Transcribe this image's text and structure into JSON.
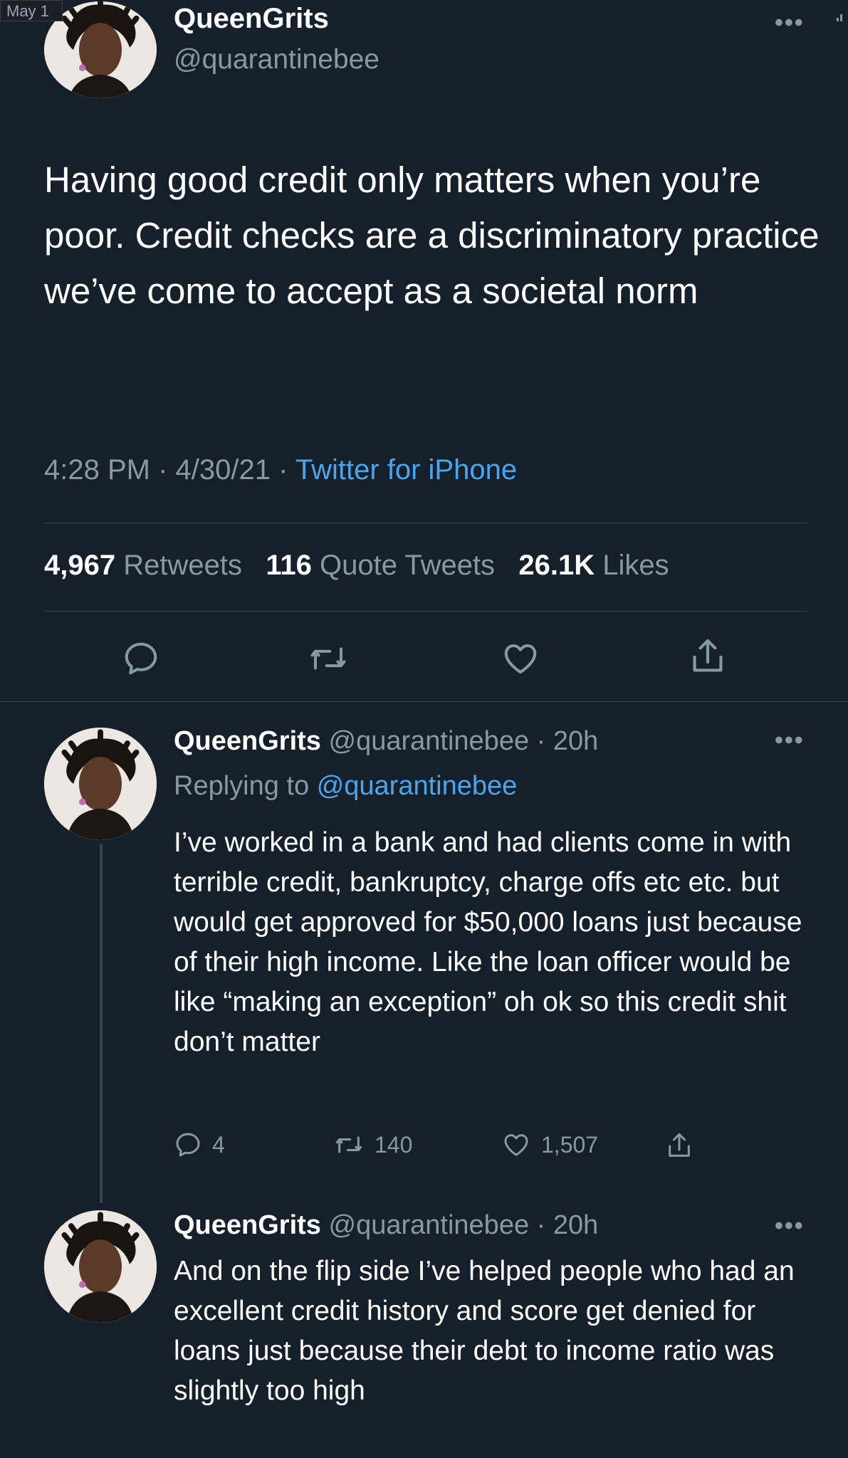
{
  "status_bar": {
    "corner_label": "May 1"
  },
  "main_tweet": {
    "display_name": "QueenGrits",
    "handle": "@quarantinebee",
    "text": "Having good credit only matters when you’re poor. Credit checks are a discriminatory practice we’ve come to accept as a societal norm",
    "time": "4:28 PM",
    "date": "4/30/21",
    "source": "Twitter for iPhone",
    "stats": {
      "retweets_count": "4,967",
      "retweets_label": "Retweets",
      "quotes_count": "116",
      "quotes_label": "Quote Tweets",
      "likes_count": "26.1K",
      "likes_label": "Likes"
    },
    "icons": [
      "reply-icon",
      "retweet-icon",
      "like-icon",
      "share-icon"
    ]
  },
  "replies": [
    {
      "display_name": "QueenGrits",
      "handle": "@quarantinebee",
      "age": "20h",
      "replying_prefix": "Replying to",
      "replying_to": "@quarantinebee",
      "text": "I’ve worked in a bank and had clients come in with terrible credit, bankruptcy, charge offs etc etc. but would get approved for $50,000 loans just because of their high income. Like the loan officer would be like “making an exception” oh ok so this credit shit don’t matter",
      "reply_count": "4",
      "retweet_count": "140",
      "like_count": "1,507"
    },
    {
      "display_name": "QueenGrits",
      "handle": "@quarantinebee",
      "age": "20h",
      "text": "And on the flip side I’ve helped people who had an excellent credit history and score get denied for loans just because their debt to income ratio was slightly too high"
    }
  ],
  "colors": {
    "background": "#15202b",
    "secondary_text": "#8899a6",
    "accent": "#4aa5ee",
    "divider": "#38444d"
  }
}
